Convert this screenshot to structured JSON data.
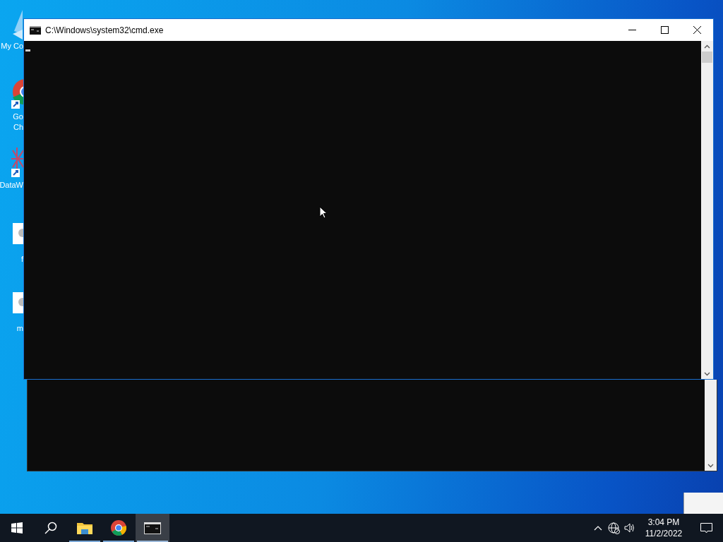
{
  "desktop_icons": [
    {
      "kind": "computer",
      "label_lines": [
        "My Co"
      ]
    },
    {
      "kind": "browser",
      "label_lines": [
        "Go",
        "Ch"
      ]
    },
    {
      "kind": "chart",
      "label_lines": [
        "DataW"
      ]
    },
    {
      "kind": "file",
      "label_lines": [
        "f"
      ]
    },
    {
      "kind": "file",
      "label_lines": [
        "m"
      ]
    }
  ],
  "console_window": {
    "title": "C:\\Windows\\system32\\cmd.exe"
  },
  "taskbar": {
    "items": [
      {
        "kind": "start",
        "active": false
      },
      {
        "kind": "search",
        "active": false
      },
      {
        "kind": "folder",
        "active": false
      },
      {
        "kind": "browser",
        "active": false
      },
      {
        "kind": "console",
        "active": true
      }
    ],
    "clock": {
      "time": "3:04 PM",
      "date": "11/2/2022"
    }
  }
}
